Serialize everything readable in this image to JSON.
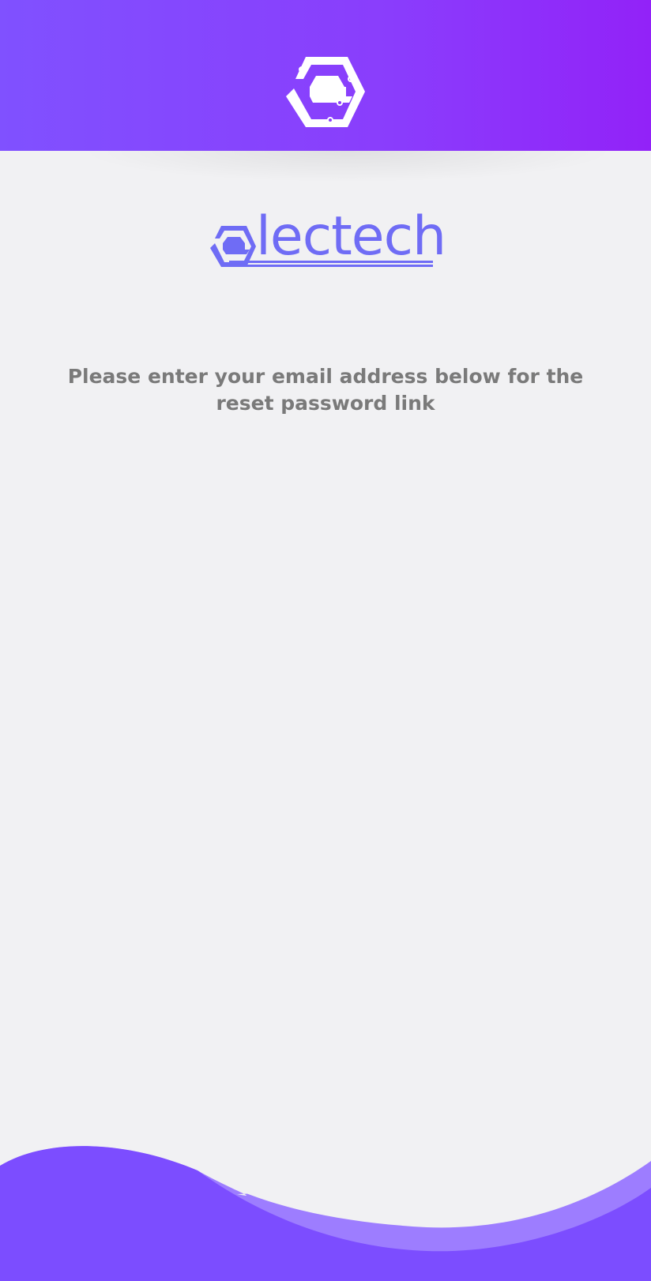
{
  "app": {
    "brand_name": "lectech"
  },
  "header": {
    "logo_icon": "electech-hex-logo"
  },
  "message": {
    "text": "Please enter your email address below for the reset password link"
  },
  "colors": {
    "header_start": "#8051ff",
    "header_end": "#9222f8",
    "brand": "#6f6cf5",
    "text": "#7a7a7a",
    "background": "#f1f1f3",
    "wave_dark": "#7c4dff",
    "wave_light": "#9d7dff"
  }
}
